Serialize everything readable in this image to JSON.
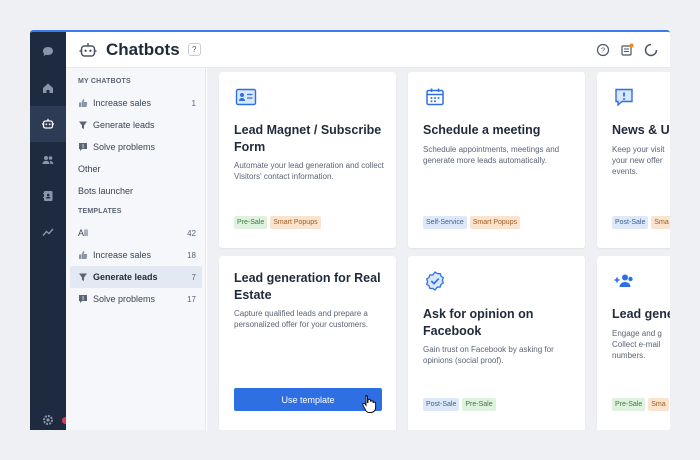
{
  "header": {
    "title": "Chatbots",
    "help_badge": "?"
  },
  "nav": {
    "my_chatbots_heading": "MY CHATBOTS",
    "my_chatbots": [
      {
        "label": "Increase sales",
        "count": "1",
        "icon": "thumbs-up-icon"
      },
      {
        "label": "Generate leads",
        "count": "",
        "icon": "funnel-icon"
      },
      {
        "label": "Solve problems",
        "count": "",
        "icon": "alert-chat-icon"
      },
      {
        "label": "Other",
        "count": "",
        "icon": ""
      },
      {
        "label": "Bots launcher",
        "count": "",
        "icon": ""
      }
    ],
    "templates_heading": "TEMPLATES",
    "templates": [
      {
        "label": "All",
        "count": "42",
        "icon": ""
      },
      {
        "label": "Increase sales",
        "count": "18",
        "icon": "thumbs-up-icon"
      },
      {
        "label": "Generate leads",
        "count": "7",
        "icon": "funnel-icon",
        "active": true
      },
      {
        "label": "Solve problems",
        "count": "17",
        "icon": "alert-chat-icon"
      }
    ]
  },
  "cards": [
    {
      "title": "Lead Magnet / Subscribe Form",
      "description": "Automate your lead generation and collect Visitors' contact information.",
      "tags": [
        {
          "label": "Pre-Sale",
          "color": "green"
        },
        {
          "label": "Smart Popups",
          "color": "orange"
        }
      ],
      "icon": "form-icon"
    },
    {
      "title": "Schedule a meeting",
      "description": "Schedule appointments, meetings and generate more leads automatically.",
      "tags": [
        {
          "label": "Self-Service",
          "color": "blue"
        },
        {
          "label": "Smart Popups",
          "color": "orange"
        }
      ],
      "icon": "calendar-icon"
    },
    {
      "title": "News & Up",
      "description": "Keep your visit your new offer events.",
      "tags": [
        {
          "label": "Post-Sale",
          "color": "blue"
        },
        {
          "label": "Sma",
          "color": "orange"
        }
      ],
      "icon": "announcement-icon"
    },
    {
      "title": "Lead generation for Real Estate",
      "description": "Capture qualified leads and prepare a personalized offer for your customers.",
      "button": "Use template",
      "icon": ""
    },
    {
      "title": "Ask for opinion on Facebook",
      "description": "Gain trust on Facebook by asking for opinions (social proof).",
      "tags": [
        {
          "label": "Post-Sale",
          "color": "blue"
        },
        {
          "label": "Pre-Sale",
          "color": "green"
        }
      ],
      "icon": "verified-badge-icon"
    },
    {
      "title": "Lead gene",
      "description": "Engage and g Collect e-mail numbers.",
      "tags": [
        {
          "label": "Pre-Sale",
          "color": "green"
        },
        {
          "label": "Sma",
          "color": "orange"
        }
      ],
      "icon": "add-user-icon"
    }
  ],
  "colors": {
    "accent": "#2f6fe4",
    "rail": "#1e2a3f"
  }
}
